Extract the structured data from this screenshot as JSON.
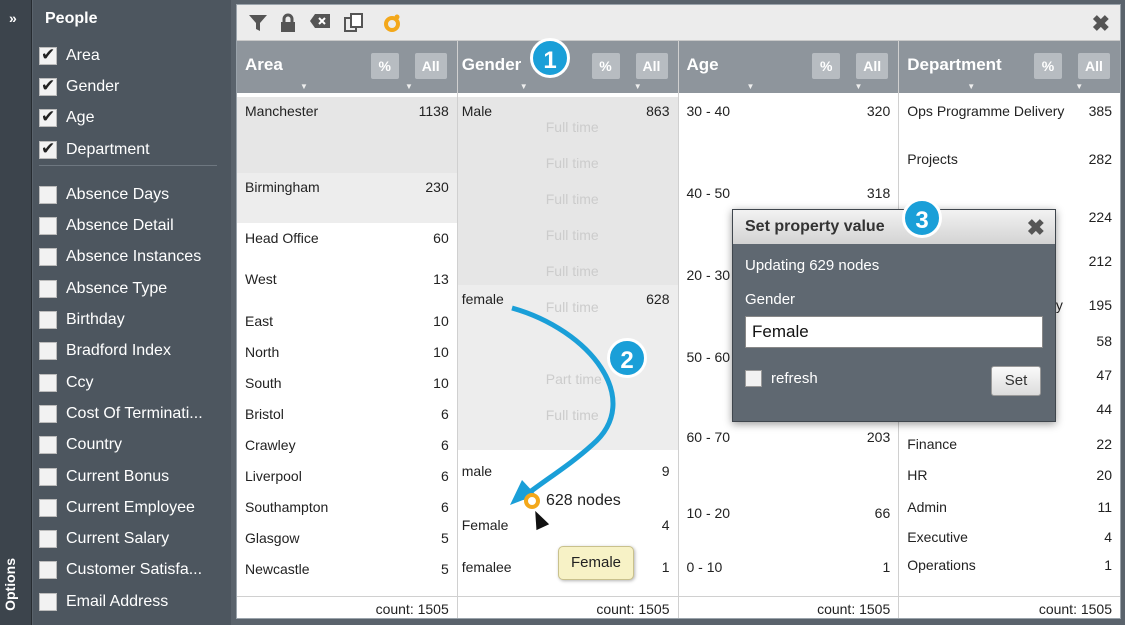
{
  "rail": {
    "expand": "»",
    "options": "Options"
  },
  "sidebar": {
    "title": "People",
    "checked": [
      {
        "label": "Area"
      },
      {
        "label": "Gender"
      },
      {
        "label": "Age"
      },
      {
        "label": "Department"
      }
    ],
    "unchecked": [
      {
        "label": "Absence Days"
      },
      {
        "label": "Absence Detail"
      },
      {
        "label": "Absence Instances"
      },
      {
        "label": "Absence Type"
      },
      {
        "label": "Birthday"
      },
      {
        "label": "Bradford Index"
      },
      {
        "label": "Ccy"
      },
      {
        "label": "Cost Of Terminati..."
      },
      {
        "label": "Country"
      },
      {
        "label": "Current Bonus"
      },
      {
        "label": "Current Employee"
      },
      {
        "label": "Current Salary"
      },
      {
        "label": "Customer Satisfa..."
      },
      {
        "label": "Email Address"
      }
    ]
  },
  "toolbar": {
    "icons": [
      "filter-icon",
      "lock-icon",
      "clear-icon",
      "copy-icon",
      "node-icon"
    ],
    "close": "✖"
  },
  "columns": {
    "area": {
      "title": "Area",
      "pct": "%",
      "all": "All",
      "count": "count: 1505",
      "rows": [
        {
          "label": "Manchester",
          "count": "1138"
        },
        {
          "label": "Birmingham",
          "count": "230"
        },
        {
          "label": "Head Office",
          "count": "60"
        },
        {
          "label": "West",
          "count": "13"
        },
        {
          "label": "East",
          "count": "10"
        },
        {
          "label": "North",
          "count": "10"
        },
        {
          "label": "South",
          "count": "10"
        },
        {
          "label": "Bristol",
          "count": "6"
        },
        {
          "label": "Crawley",
          "count": "6"
        },
        {
          "label": "Liverpool",
          "count": "6"
        },
        {
          "label": "Southampton",
          "count": "6"
        },
        {
          "label": "Glasgow",
          "count": "5"
        },
        {
          "label": "Newcastle",
          "count": "5"
        }
      ]
    },
    "gender": {
      "title": "Gender",
      "pct": "%",
      "all": "All",
      "count": "count: 1505",
      "rows": [
        {
          "label": "Male",
          "count": "863"
        },
        {
          "label": "female",
          "count": "628"
        },
        {
          "label": "male",
          "count": "9"
        },
        {
          "label": "Female",
          "count": "4"
        },
        {
          "label": "femalee",
          "count": "1"
        }
      ],
      "ghost": [
        "Full time",
        "Full time",
        "Full time",
        "Full time",
        "Full time",
        "Full time",
        "Part time",
        "Full time"
      ]
    },
    "age": {
      "title": "Age",
      "pct": "%",
      "all": "All",
      "count": "count: 1505",
      "rows": [
        {
          "label": "30 - 40",
          "count": "320"
        },
        {
          "label": "40 - 50",
          "count": "318"
        },
        {
          "label": "20 - 30",
          "count": ""
        },
        {
          "label": "50 - 60",
          "count": ""
        },
        {
          "label": "60 - 70",
          "count": "203"
        },
        {
          "label": "10 - 20",
          "count": "66"
        },
        {
          "label": "0 - 10",
          "count": "1"
        }
      ]
    },
    "department": {
      "title": "Department",
      "pct": "%",
      "all": "All",
      "count": "count: 1505",
      "rows": [
        {
          "label": "Ops Programme Delivery",
          "count": "385"
        },
        {
          "label": "Projects",
          "count": "282"
        },
        {
          "label": "",
          "count": "224"
        },
        {
          "label": "",
          "count": "212"
        },
        {
          "label": "ry",
          "count": "195"
        },
        {
          "label": "",
          "count": "58"
        },
        {
          "label": "",
          "count": "47"
        },
        {
          "label": "",
          "count": "44"
        },
        {
          "label": "Finance",
          "count": "22"
        },
        {
          "label": "HR",
          "count": "20"
        },
        {
          "label": "Admin",
          "count": "11"
        },
        {
          "label": "Executive",
          "count": "4"
        },
        {
          "label": "Operations",
          "count": "1"
        }
      ]
    }
  },
  "dialog": {
    "title": "Set property value",
    "info": "Updating 629 nodes",
    "field_label": "Gender",
    "field_value": "Female",
    "refresh_label": "refresh",
    "set_label": "Set"
  },
  "drag": {
    "nodes_label": "628 nodes",
    "tooltip": "Female"
  },
  "badges": [
    "1",
    "2",
    "3"
  ],
  "colors": {
    "accent": "#1a9fd8",
    "header": "#8e959c",
    "sidebar": "#4d565f"
  }
}
